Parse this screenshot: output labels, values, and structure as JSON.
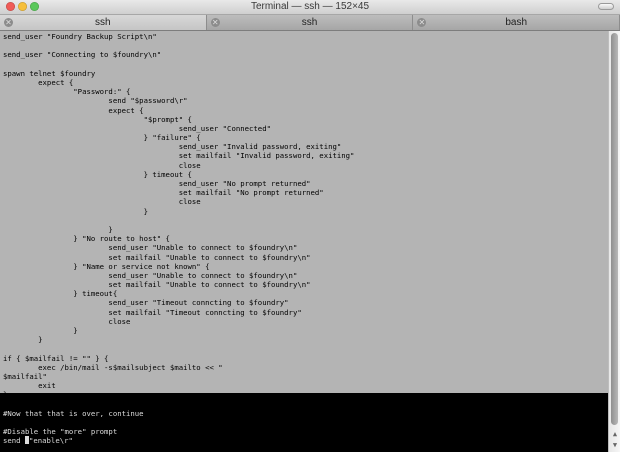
{
  "window": {
    "title": "Terminal — ssh — 152×45"
  },
  "tabs": [
    {
      "label": "ssh",
      "active": true
    },
    {
      "label": "ssh",
      "active": false
    },
    {
      "label": "bash",
      "active": false
    }
  ],
  "terminal": {
    "selected_lines": [
      "send_user \"Foundry Backup Script\\n\"",
      "",
      "send_user \"Connecting to $foundry\\n\"",
      "",
      "spawn telnet $foundry",
      "        expect {",
      "                \"Password:\" {",
      "                        send \"$password\\r\"",
      "                        expect {",
      "                                \"$prompt\" {",
      "                                        send_user \"Connected\"",
      "                                } \"failure\" {",
      "                                        send_user \"Invalid password, exiting\"",
      "                                        set mailfail \"Invalid password, exiting\"",
      "                                        close",
      "                                } timeout {",
      "                                        send_user \"No prompt returned\"",
      "                                        set mailfail \"No prompt returned\"",
      "                                        close",
      "                                }",
      "",
      "                        }",
      "                } \"No route to host\" {",
      "                        send_user \"Unable to connect to $foundry\\n\"",
      "                        set mailfail \"Unable to connect to $foundry\\n\"",
      "                } \"Name or service not known\" {",
      "                        send_user \"Unable to connect to $foundry\\n\"",
      "                        set mailfail \"Unable to connect to $foundry\\n\"",
      "                } timeout{",
      "                        send_user \"Timeout conncting to $foundry\"",
      "                        set mailfail \"Timeout conncting to $foundry\"",
      "                        close",
      "                }",
      "        }",
      "",
      "if { $mailfail != \"\" } {",
      "        exec /bin/mail -s$mailsubject $mailto << \"",
      "$mailfail\"",
      "        exit",
      "}"
    ],
    "plain_lines": [
      "",
      "#Now that that is over, continue",
      "",
      "#Disable the \"more\" prompt"
    ],
    "last_line_prefix": "send ",
    "last_line_suffix": "\"enable\\r\""
  },
  "colors": {
    "selection": "#b4b4b4",
    "background": "#000000",
    "text_on_selection": "#000000",
    "text_plain": "#dcdcdc"
  }
}
